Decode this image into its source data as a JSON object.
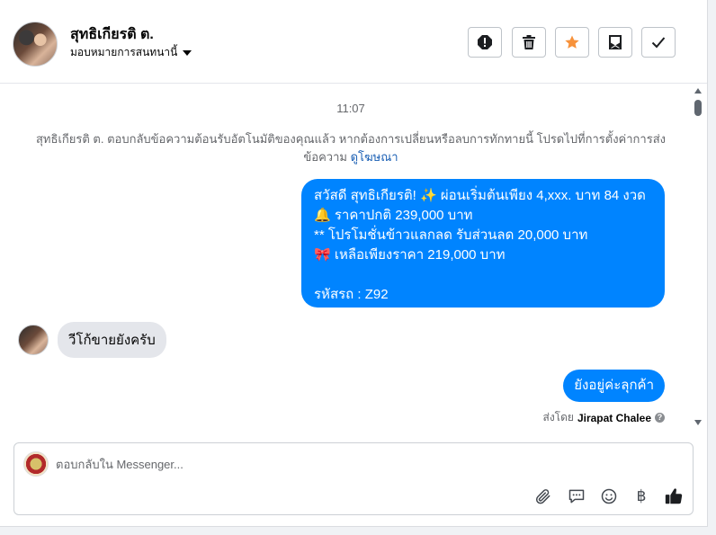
{
  "header": {
    "contact_name": "สุทธิเกียรติ ต.",
    "assign_label": "มอบหมายการสนทนานี้",
    "buttons": [
      {
        "name": "spam",
        "icon": "exclamation-icon"
      },
      {
        "name": "delete",
        "icon": "trash-icon"
      },
      {
        "name": "star",
        "icon": "star-icon",
        "color": "#f7923b"
      },
      {
        "name": "archive",
        "icon": "archive-icon"
      },
      {
        "name": "done",
        "icon": "check-icon"
      }
    ]
  },
  "chat": {
    "timestamp": "11:07",
    "notice_text": "สุทธิเกียรติ ต. ตอบกลับข้อความต้อนรับอัตโนมัติของคุณแล้ว หากต้องการเปลี่ยนหรือลบการทักทายนี้ โปรดไปที่การตั้งค่าการส่งข้อความ",
    "notice_link": "ดูโฆษณา",
    "outgoing_1_lines": [
      "สวัสดี สุทธิเกียรติ! ✨  ผ่อนเริ่มต้นเพียง 4,xxx. บาท 84 งวด",
      "🔔 ราคาปกติ 239,000 บาท",
      "** โปรโมชั่นข้าวแลกลด รับส่วนลด 20,000 บาท",
      "🎀  เหลือเพียงราคา 219,000 บาท",
      "",
      " รหัสรถ : Z92"
    ],
    "incoming_1": "วีโก้ขายยังครับ",
    "outgoing_2": "ยังอยู่ค่ะลุกค้า",
    "sent_by_prefix": "ส่งโดย",
    "sent_by_name": "Jirapat Chalee",
    "accent_color": "#0084ff"
  },
  "composer": {
    "placeholder": "ตอบกลับใน Messenger...",
    "value": "",
    "tools": [
      "paperclip-icon",
      "saved-reply-icon",
      "emoji-icon",
      "baht-icon",
      "like-icon"
    ],
    "baht_symbol": "฿"
  }
}
